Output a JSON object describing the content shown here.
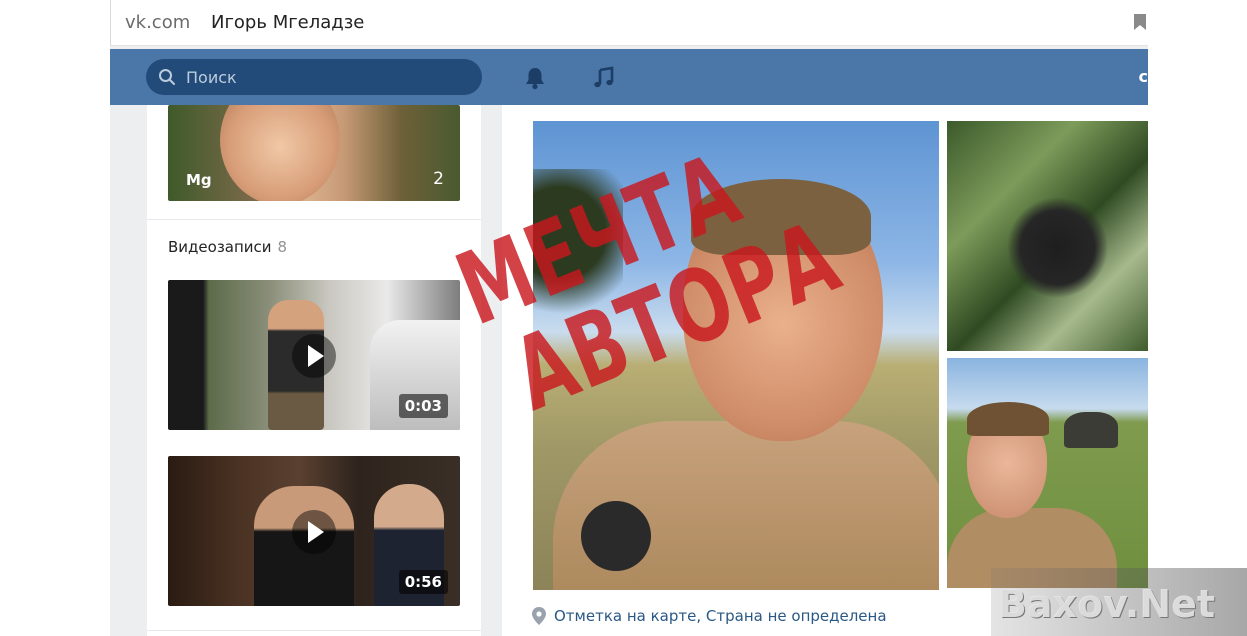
{
  "browser": {
    "domain": "vk.com",
    "title": "Игорь Мгеладзе"
  },
  "header": {
    "search_placeholder": "Поиск",
    "cut_text": "c",
    "accent_color": "#4a76a8"
  },
  "left": {
    "album": {
      "name": "Mg",
      "count": "2"
    },
    "videos_section": {
      "title": "Видеозаписи",
      "count": "8"
    },
    "videos": [
      {
        "duration": "0:03"
      },
      {
        "duration": "0:56"
      }
    ]
  },
  "right": {
    "location": "Отметка на карте, Страна не определена"
  },
  "watermarks": {
    "stamp_line1": "МЕЧТА",
    "stamp_line2": "АВТОРА",
    "corner": "Baxov.Net"
  }
}
